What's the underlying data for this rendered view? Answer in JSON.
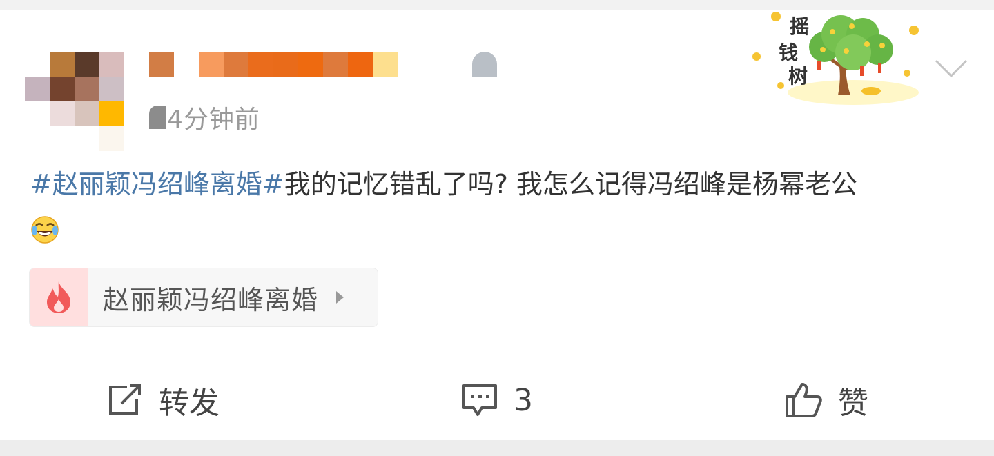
{
  "post": {
    "time": "4分钟前",
    "topic": "#赵丽颖冯绍峰离婚#",
    "text": "我的记忆错乱了吗? 我怎么记得冯绍峰是杨幂老公"
  },
  "badge": {
    "text": "摇钱树"
  },
  "topic_card": {
    "label": "赵丽颖冯绍峰离婚"
  },
  "actions": {
    "repost_label": "转发",
    "comment_count": "3",
    "like_label": "赞"
  },
  "colors": {
    "link": "#4a78a8",
    "text": "#333333",
    "muted": "#999999",
    "fire": "#f15a5a"
  }
}
